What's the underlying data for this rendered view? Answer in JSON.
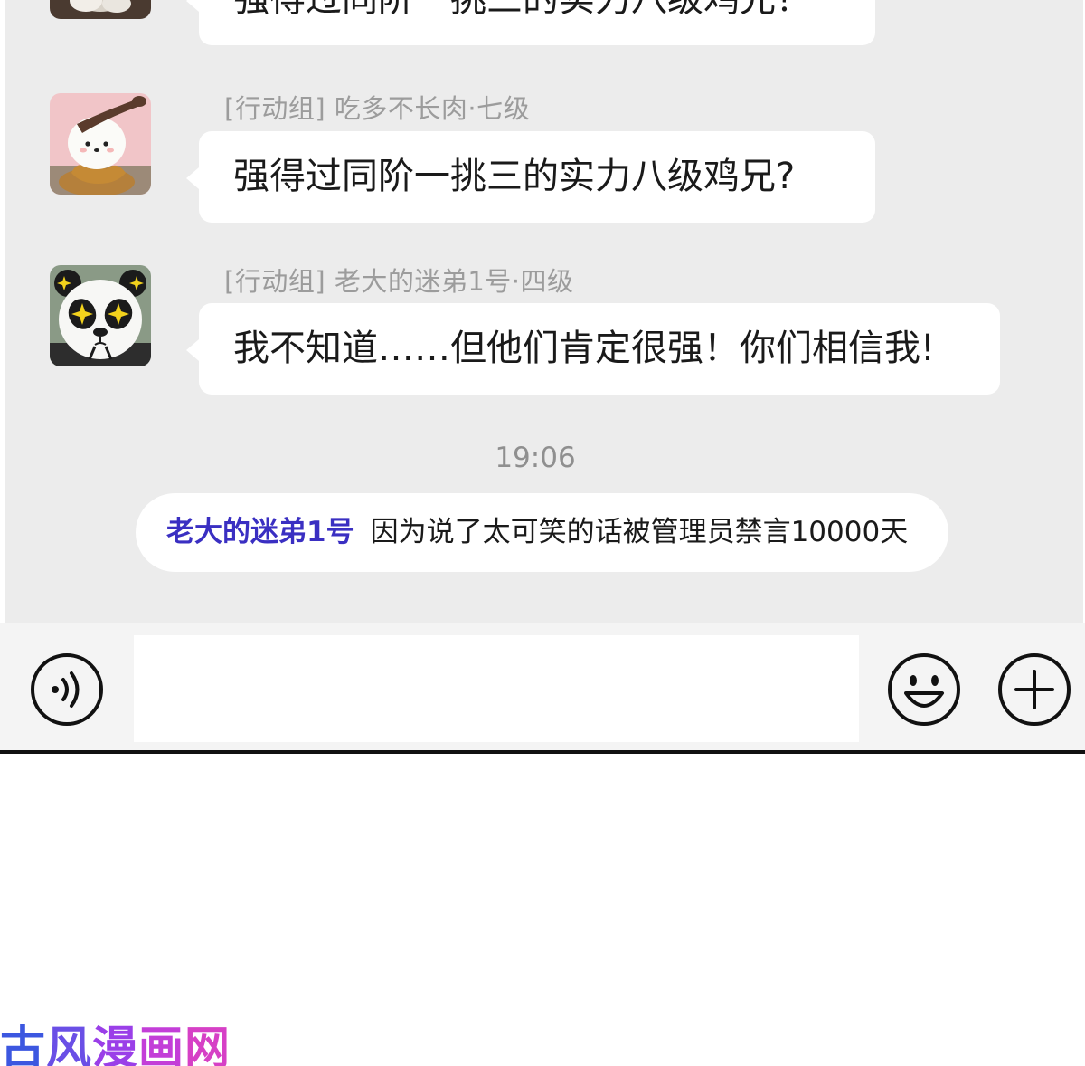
{
  "messages": [
    {
      "sender": "",
      "text": "强得过同阶一挑三的实力八级鸡兄？"
    },
    {
      "sender": "[行动组] 吃多不长肉·七级",
      "text": "强得过同阶一挑三的实力八级鸡兄?"
    },
    {
      "sender": "[行动组] 老大的迷弟1号·四级",
      "text": "我不知道……但他们肯定很强！你们相信我!"
    }
  ],
  "avatars": [
    "cat-avatar",
    "dog-pastry-avatar",
    "panda-avatar"
  ],
  "time_divider": "19:06",
  "system_notice": {
    "user": "老大的迷弟1号",
    "text": "因为说了太可笑的话被管理员禁言10000天"
  },
  "input_bar": {
    "placeholder": "",
    "voice_icon": "voice-icon",
    "emoji_icon": "emoji-icon",
    "plus_icon": "plus-icon"
  },
  "watermark": [
    "古",
    "风",
    "漫",
    "画",
    "网"
  ],
  "colors": {
    "chat_bg": "#ececec",
    "bubble": "#ffffff",
    "notice_name": "#3a2fc2"
  }
}
